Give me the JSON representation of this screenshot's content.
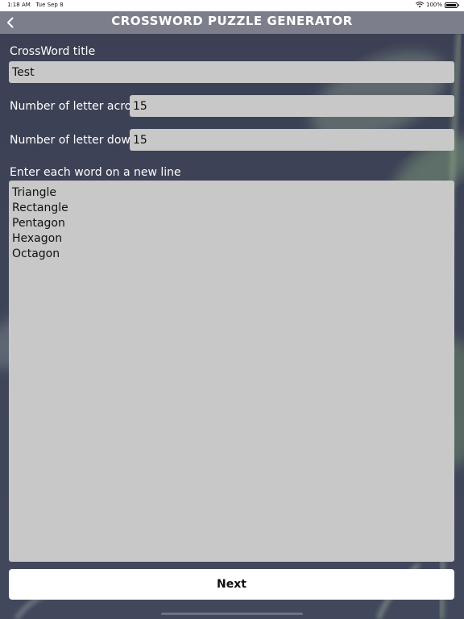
{
  "status_bar": {
    "time": "1:18 AM",
    "date": "Tue Sep 8",
    "battery_text": "100%",
    "battery_level": 1.0
  },
  "nav": {
    "title": "CROSSWORD PUZZLE GENERATOR",
    "back_icon": "chevron-left-icon"
  },
  "form": {
    "title_label": "CrossWord title",
    "title_value": "Test",
    "across_label": "Number of letter across",
    "across_value": "15",
    "down_label": "Number of letter down",
    "down_value": "15",
    "words_label": "Enter each word on a new line",
    "words": [
      "Triangle",
      "Rectangle",
      "Pentagon",
      "Hexagon",
      "Octagon"
    ]
  },
  "next_button": "Next",
  "colors": {
    "background": "#3c4156",
    "nav_bar": "#7c7f8b",
    "field": "#c8c8c8",
    "button": "#ffffff"
  }
}
